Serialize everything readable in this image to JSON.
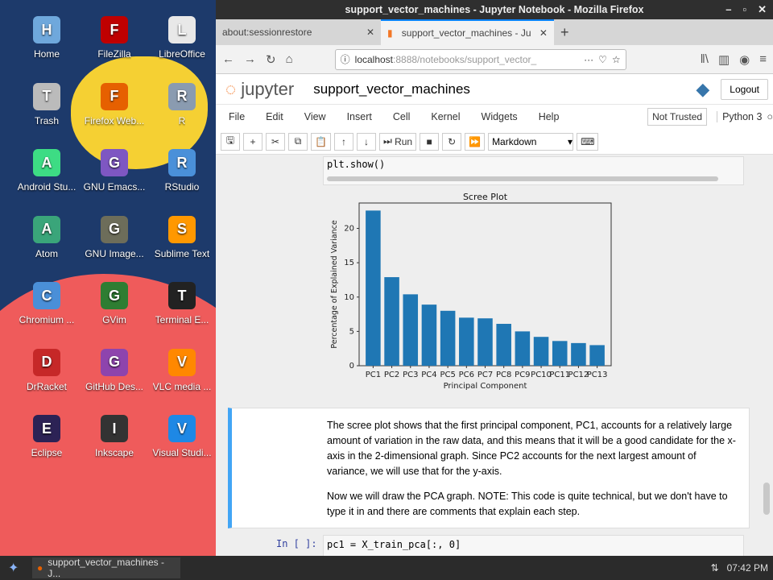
{
  "desktop": {
    "icons": [
      {
        "label": "Home",
        "icon": "folder-home-icon",
        "color": "#6fa8dc"
      },
      {
        "label": "FileZilla",
        "icon": "filezilla-icon",
        "color": "#bf0000"
      },
      {
        "label": "LibreOffice",
        "icon": "document-icon",
        "color": "#e8e8e8"
      },
      {
        "label": "Trash",
        "icon": "trash-icon",
        "color": "#bbbbbb"
      },
      {
        "label": "Firefox Web...",
        "icon": "firefox-icon",
        "color": "#e66000"
      },
      {
        "label": "R",
        "icon": "r-icon",
        "color": "#8a9bb0"
      },
      {
        "label": "Android Stu...",
        "icon": "android-studio-icon",
        "color": "#3ddc84"
      },
      {
        "label": "GNU Emacs...",
        "icon": "emacs-icon",
        "color": "#7e57c2"
      },
      {
        "label": "RStudio",
        "icon": "rstudio-icon",
        "color": "#4a90d9"
      },
      {
        "label": "Atom",
        "icon": "atom-icon",
        "color": "#3aa57a"
      },
      {
        "label": "GNU Image...",
        "icon": "gimp-icon",
        "color": "#6d6d5a"
      },
      {
        "label": "Sublime Text",
        "icon": "sublime-icon",
        "color": "#ff9800"
      },
      {
        "label": "Chromium ...",
        "icon": "chromium-icon",
        "color": "#4a8fd8"
      },
      {
        "label": "GVim",
        "icon": "vim-icon",
        "color": "#2e7d32"
      },
      {
        "label": "Terminal E...",
        "icon": "terminal-icon",
        "color": "#222222"
      },
      {
        "label": "DrRacket",
        "icon": "racket-icon",
        "color": "#c62828"
      },
      {
        "label": "GitHub Des...",
        "icon": "github-icon",
        "color": "#8e44ad"
      },
      {
        "label": "VLC media ...",
        "icon": "vlc-icon",
        "color": "#ff8800"
      },
      {
        "label": "Eclipse",
        "icon": "eclipse-icon",
        "color": "#2c2255"
      },
      {
        "label": "Inkscape",
        "icon": "inkscape-icon",
        "color": "#333333"
      },
      {
        "label": "Visual Studi...",
        "icon": "vscode-icon",
        "color": "#1e88e5"
      }
    ]
  },
  "taskbar": {
    "task": "support_vector_machines - J...",
    "clock": "07:42 PM"
  },
  "browser": {
    "title": "support_vector_machines - Jupyter Notebook - Mozilla Firefox",
    "tabs": [
      {
        "label": "about:sessionrestore"
      },
      {
        "label": "support_vector_machines - Ju"
      }
    ],
    "url_host": "localhost",
    "url_rest": ":8888/notebooks/support_vector_"
  },
  "jupyter": {
    "logo": "jupyter",
    "notebook_name": "support_vector_machines",
    "logout": "Logout",
    "menu": [
      "File",
      "Edit",
      "View",
      "Insert",
      "Cell",
      "Kernel",
      "Widgets",
      "Help"
    ],
    "not_trusted": "Not Trusted",
    "kernel": "Python 3",
    "run": "Run",
    "cell_type": "Markdown",
    "code_tail": "plt.show()",
    "markdown": [
      "The scree plot shows that the first principal component, PC1, accounts for a relatively large amount of variation in the raw data, and this means that it will be a good candidate for the x-axis in the 2-dimensional graph. Since PC2 accounts for the next largest amount of variance, we will use that for the y-axis.",
      "Now we will draw the PCA graph. NOTE: This code is quite technical, but we don't have to type it in and there are comments that explain each step."
    ],
    "next_prompt": "In [ ]:",
    "next_code": "pc1 = X_train_pca[:, 0]"
  },
  "chart_data": {
    "type": "bar",
    "title": "Scree Plot",
    "xlabel": "Principal Component",
    "ylabel": "Percentage of Explained Variance",
    "categories": [
      "PC1",
      "PC2",
      "PC3",
      "PC4",
      "PC5",
      "PC6",
      "PC7",
      "PC8",
      "PC9",
      "PC10",
      "PC11",
      "PC12",
      "PC13"
    ],
    "values": [
      22.6,
      12.9,
      10.4,
      8.9,
      8.0,
      7.0,
      6.9,
      6.1,
      5.0,
      4.2,
      3.6,
      3.3,
      3.0
    ],
    "ylim": [
      0,
      23.7
    ],
    "yticks": [
      0,
      5,
      10,
      15,
      20
    ],
    "grid": false,
    "color": "#1f77b4"
  }
}
